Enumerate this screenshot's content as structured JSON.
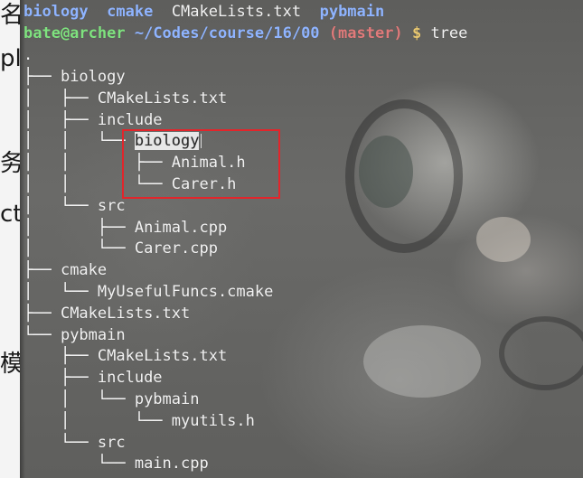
{
  "doc_fragments": [
    "名",
    "pl",
    "务:",
    "ct",
    "模块"
  ],
  "terminal": {
    "title_tabs": [
      "biology",
      "cmake",
      "CMakeLists.txt",
      "pybmain"
    ],
    "prompt": {
      "user_host": "bate@archer",
      "path": "~/Codes/course/16/00",
      "branch": "(master)",
      "symbol": "$",
      "command": "tree"
    },
    "tree_root": ".",
    "entries": [
      {
        "prefix": "├── ",
        "name": "biology",
        "is_dir": true
      },
      {
        "prefix": "│   ├── ",
        "name": "CMakeLists.txt",
        "is_dir": false
      },
      {
        "prefix": "│   ├── ",
        "name": "include",
        "is_dir": true
      },
      {
        "prefix": "│   │   └── ",
        "name": "biology",
        "is_dir": true,
        "selected": true
      },
      {
        "prefix": "│   │       ├── ",
        "name": "Animal.h",
        "is_dir": false
      },
      {
        "prefix": "│   │       └── ",
        "name": "Carer.h",
        "is_dir": false
      },
      {
        "prefix": "│   └── ",
        "name": "src",
        "is_dir": true
      },
      {
        "prefix": "│       ├── ",
        "name": "Animal.cpp",
        "is_dir": false
      },
      {
        "prefix": "│       └── ",
        "name": "Carer.cpp",
        "is_dir": false
      },
      {
        "prefix": "├── ",
        "name": "cmake",
        "is_dir": true
      },
      {
        "prefix": "│   └── ",
        "name": "MyUsefulFuncs.cmake",
        "is_dir": false
      },
      {
        "prefix": "├── ",
        "name": "CMakeLists.txt",
        "is_dir": false
      },
      {
        "prefix": "└── ",
        "name": "pybmain",
        "is_dir": true
      },
      {
        "prefix": "    ├── ",
        "name": "CMakeLists.txt",
        "is_dir": false
      },
      {
        "prefix": "    ├── ",
        "name": "include",
        "is_dir": true
      },
      {
        "prefix": "    │   └── ",
        "name": "pybmain",
        "is_dir": true
      },
      {
        "prefix": "    │       └── ",
        "name": "myutils.h",
        "is_dir": false
      },
      {
        "prefix": "    └── ",
        "name": "src",
        "is_dir": true
      },
      {
        "prefix": "        └── ",
        "name": "main.cpp",
        "is_dir": false
      }
    ],
    "colors": {
      "directory_tab": "#8fb4ff",
      "user_host": "#7fe27f",
      "branch": "#e07a7a",
      "highlight_box": "#e2252b",
      "selection_bg": "#e7e7e7"
    }
  }
}
